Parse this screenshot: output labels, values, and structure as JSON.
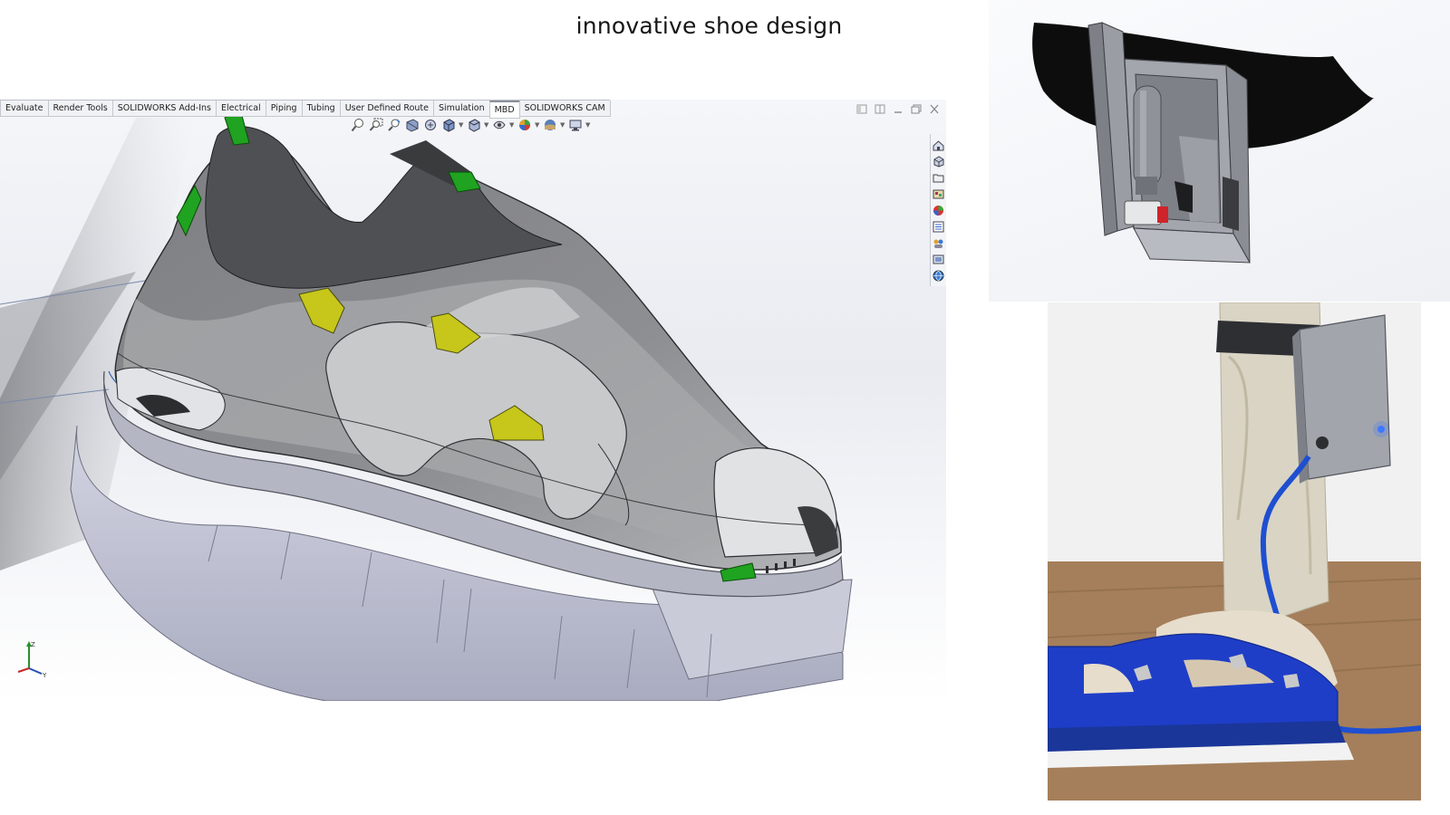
{
  "page": {
    "title": "innovative shoe design"
  },
  "cad": {
    "tabs": [
      {
        "label": "Evaluate",
        "active": false
      },
      {
        "label": "Render Tools",
        "active": false
      },
      {
        "label": "SOLIDWORKS Add-Ins",
        "active": false
      },
      {
        "label": "Electrical",
        "active": false
      },
      {
        "label": "Piping",
        "active": false
      },
      {
        "label": "Tubing",
        "active": false
      },
      {
        "label": "User Defined Route",
        "active": false
      },
      {
        "label": "Simulation",
        "active": false
      },
      {
        "label": "MBD",
        "active": true
      },
      {
        "label": "SOLIDWORKS CAM",
        "active": false
      }
    ],
    "window_controls": [
      "restore-panel-icon",
      "split-panel-icon",
      "minimize-icon",
      "maximize-icon",
      "close-icon"
    ],
    "heads_up_toolbar": [
      "zoom-to-fit-icon",
      "zoom-to-area-icon",
      "previous-view-icon",
      "section-view-icon",
      "dynamic-annotation-icon",
      "view-orientation-icon",
      "display-style-icon",
      "hide-show-icon",
      "edit-appearance-icon",
      "apply-scene-icon",
      "view-settings-icon"
    ],
    "task_pane": [
      "home-icon",
      "design-library-icon",
      "file-explorer-icon",
      "view-palette-icon",
      "appearances-icon",
      "custom-properties-icon",
      "solidworks-forum-icon",
      "resources-icon",
      "community-icon"
    ],
    "colors": {
      "upper": "#8a8b8d",
      "panel": "#b9babd",
      "sole": "#c7c9d9",
      "accent_yellow": "#c6c61b",
      "accent_green": "#1fa320"
    }
  },
  "photos": [
    {
      "name": "enclosure-render",
      "colors": {
        "box": "#8e9198",
        "strap": "#0d0d0d",
        "handle": "#d0232a"
      }
    },
    {
      "name": "prototype-photo",
      "colors": {
        "shoe": "#1e3ec8",
        "tube": "#1f4fd1",
        "floor": "#9a7a58",
        "led": "#3f78ff"
      }
    }
  ]
}
